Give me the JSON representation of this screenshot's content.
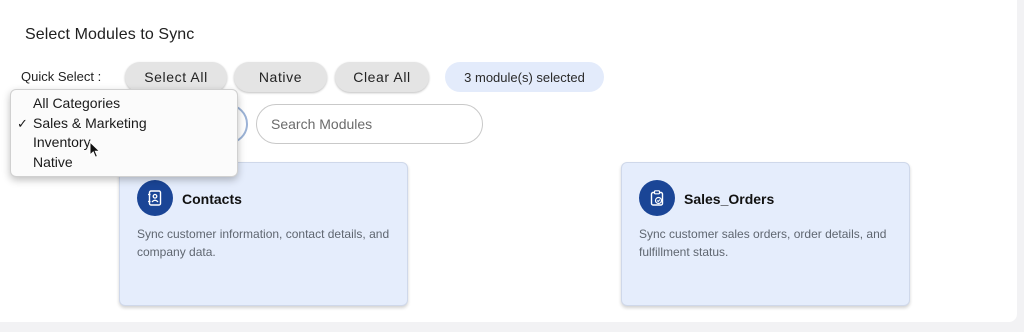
{
  "title": "Select Modules to Sync",
  "quick_select": {
    "label": "Quick Select :",
    "buttons": [
      "Select All",
      "Native",
      "Clear All"
    ],
    "selected_badge": "3 module(s) selected"
  },
  "filter": {
    "options": [
      {
        "label": "All Categories",
        "checked": false
      },
      {
        "label": "Sales & Marketing",
        "checked": true
      },
      {
        "label": "Inventory",
        "checked": false
      },
      {
        "label": "Native",
        "checked": false
      }
    ],
    "check_mark": "✓"
  },
  "search": {
    "placeholder": "Search Modules"
  },
  "modules": [
    {
      "name": "Contacts",
      "icon": "contact-book-icon",
      "description": "Sync customer information, contact details, and company data."
    },
    {
      "name": "Sales_Orders",
      "icon": "clipboard-check-icon",
      "description": "Sync customer sales orders, order details, and fulfillment status."
    }
  ],
  "colors": {
    "accent": "#1a4596",
    "card_bg": "#e5edfc",
    "badge_bg": "#e3ebfb"
  }
}
